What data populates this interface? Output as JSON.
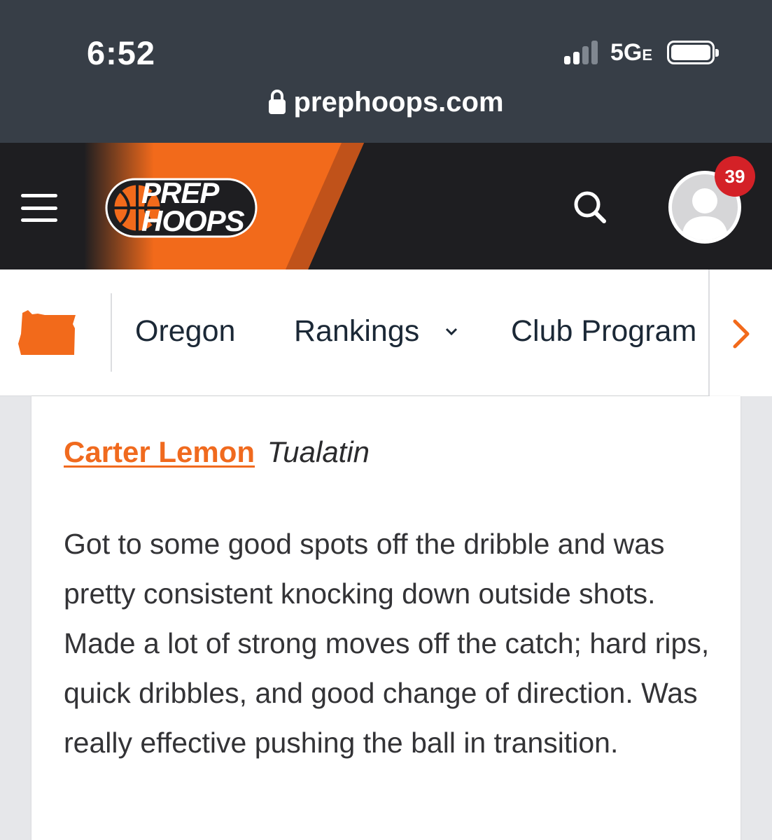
{
  "status_bar": {
    "time": "6:52",
    "network": "5G",
    "network_suffix": "E",
    "signal_bars_active": 2,
    "signal_bars_total": 4,
    "battery_level": 1.0
  },
  "browser": {
    "url": "prephoops.com",
    "secure": true
  },
  "header": {
    "logo_line1": "PREP",
    "logo_line2": "HOOPS",
    "notification_count": "39",
    "brand_orange": "#f26a1b",
    "background": "#1e1e21"
  },
  "subnav": {
    "state_label": "Oregon",
    "items": [
      {
        "label": "Oregon"
      },
      {
        "label": "Rankings"
      },
      {
        "label": "Club Program"
      }
    ]
  },
  "article": {
    "player_name": "Carter Lemon",
    "school": "Tualatin",
    "report": "Got to some good spots off the dribble and was pretty consistent knocking down outside shots. Made a lot of strong moves off the catch; hard rips, quick dribbles, and good change of direction. Was really effective pushing the ball in transition."
  }
}
